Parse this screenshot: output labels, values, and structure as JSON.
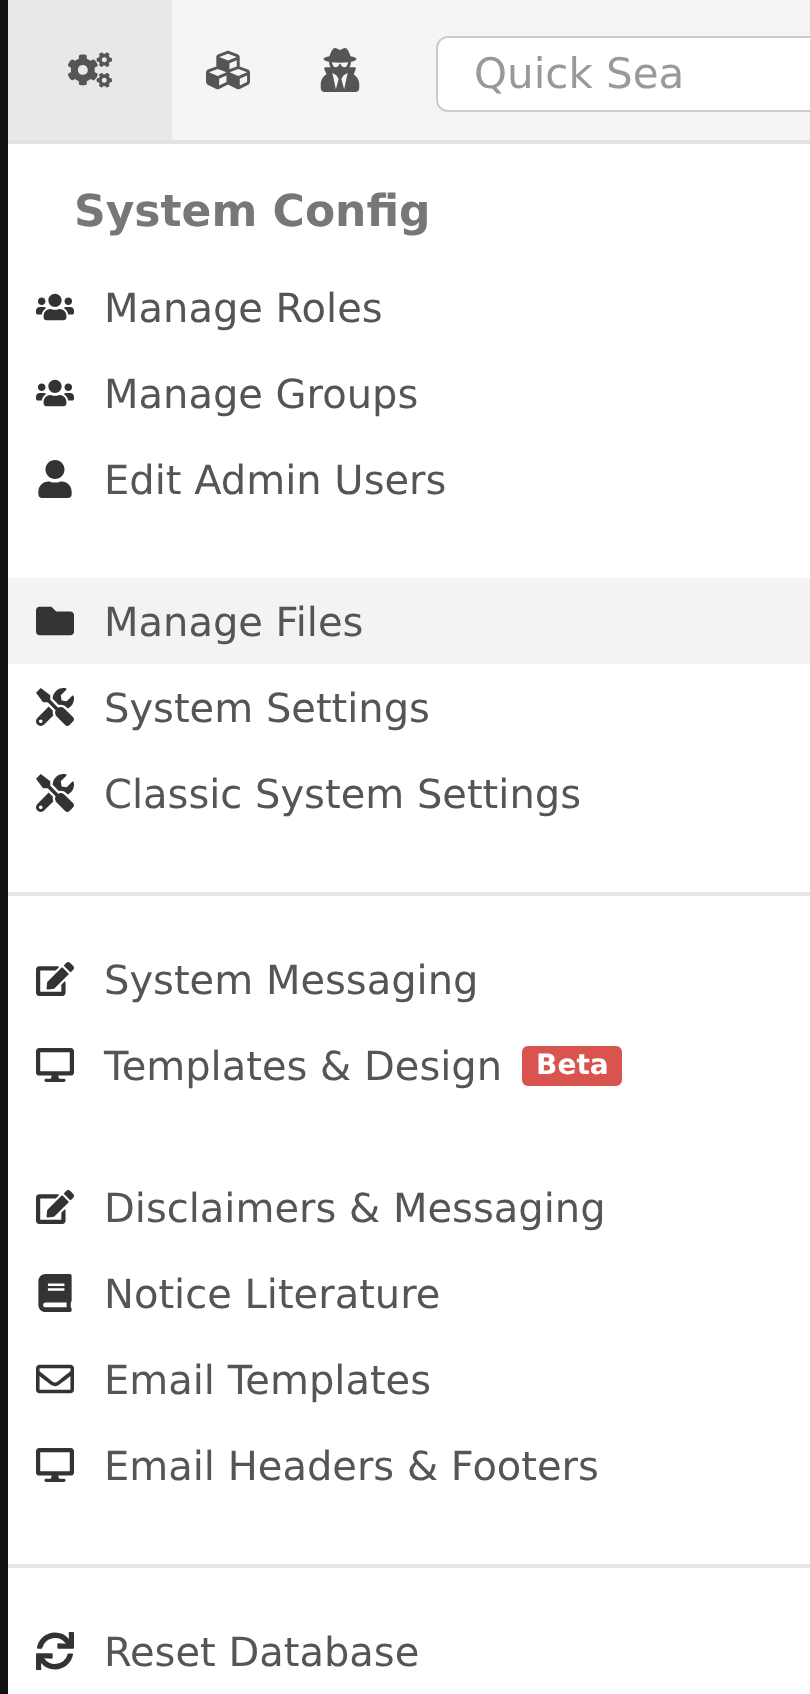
{
  "toolbar": {
    "tabs": [
      {
        "selected": true
      },
      {
        "selected": false
      },
      {
        "selected": false
      }
    ],
    "search": {
      "placeholder": "Quick Sea"
    }
  },
  "menu": {
    "heading": "System Config",
    "groups": [
      {
        "divided": false,
        "items": [
          {
            "label": "Manage Roles",
            "selected": false
          },
          {
            "label": "Manage Groups",
            "selected": false
          },
          {
            "label": "Edit Admin Users",
            "selected": false
          }
        ]
      },
      {
        "divided": false,
        "items": [
          {
            "label": "Manage Files",
            "selected": true
          },
          {
            "label": "System Settings",
            "selected": false
          },
          {
            "label": "Classic System Settings",
            "selected": false
          }
        ]
      },
      {
        "divided": true,
        "items": [
          {
            "label": "System Messaging",
            "selected": false
          },
          {
            "label": "Templates & Design",
            "selected": false,
            "badge": "Beta"
          }
        ]
      },
      {
        "divided": false,
        "items": [
          {
            "label": "Disclaimers & Messaging",
            "selected": false
          },
          {
            "label": "Notice Literature",
            "selected": false
          },
          {
            "label": "Email Templates",
            "selected": false
          },
          {
            "label": "Email Headers & Footers",
            "selected": false
          }
        ]
      },
      {
        "divided": true,
        "items": [
          {
            "label": "Reset Database",
            "selected": false
          }
        ]
      }
    ]
  }
}
